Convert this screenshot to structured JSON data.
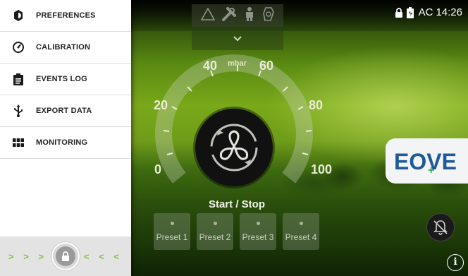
{
  "status_bar": {
    "alert_icons": [
      "warning-triangle-icon",
      "tools-icon",
      "person-icon",
      "ventilator-icon"
    ],
    "lock_icon": "lock-icon",
    "battery_icon": "battery-charging-icon",
    "power_source": "AC",
    "time": "14:26"
  },
  "drawer": {
    "items": [
      {
        "label": "PREFERENCES",
        "icon": "settings-icon"
      },
      {
        "label": "CALIBRATION",
        "icon": "gauge-icon"
      },
      {
        "label": "EVENTS LOG",
        "icon": "clipboard-icon"
      },
      {
        "label": "EXPORT DATA",
        "icon": "usb-icon"
      },
      {
        "label": "MONITORING",
        "icon": "grid-icon"
      }
    ],
    "unlock": {
      "left_arrows": "> > >",
      "right_arrows": "< < <",
      "icon": "lock-icon"
    }
  },
  "gauge": {
    "unit": "mbar",
    "min": 0,
    "max": 100,
    "tick_labels": [
      "0",
      "20",
      "40",
      "60",
      "80",
      "100"
    ],
    "value": 0
  },
  "main": {
    "start_stop_label": "Start / Stop",
    "presets": [
      "Preset 1",
      "Preset 2",
      "Preset 3",
      "Preset 4"
    ],
    "brand": "EOVE",
    "colors": {
      "accent_green": "#7cc23a",
      "brand_blue": "#1e5a9a",
      "brand_plus": "#2fa84f"
    }
  }
}
